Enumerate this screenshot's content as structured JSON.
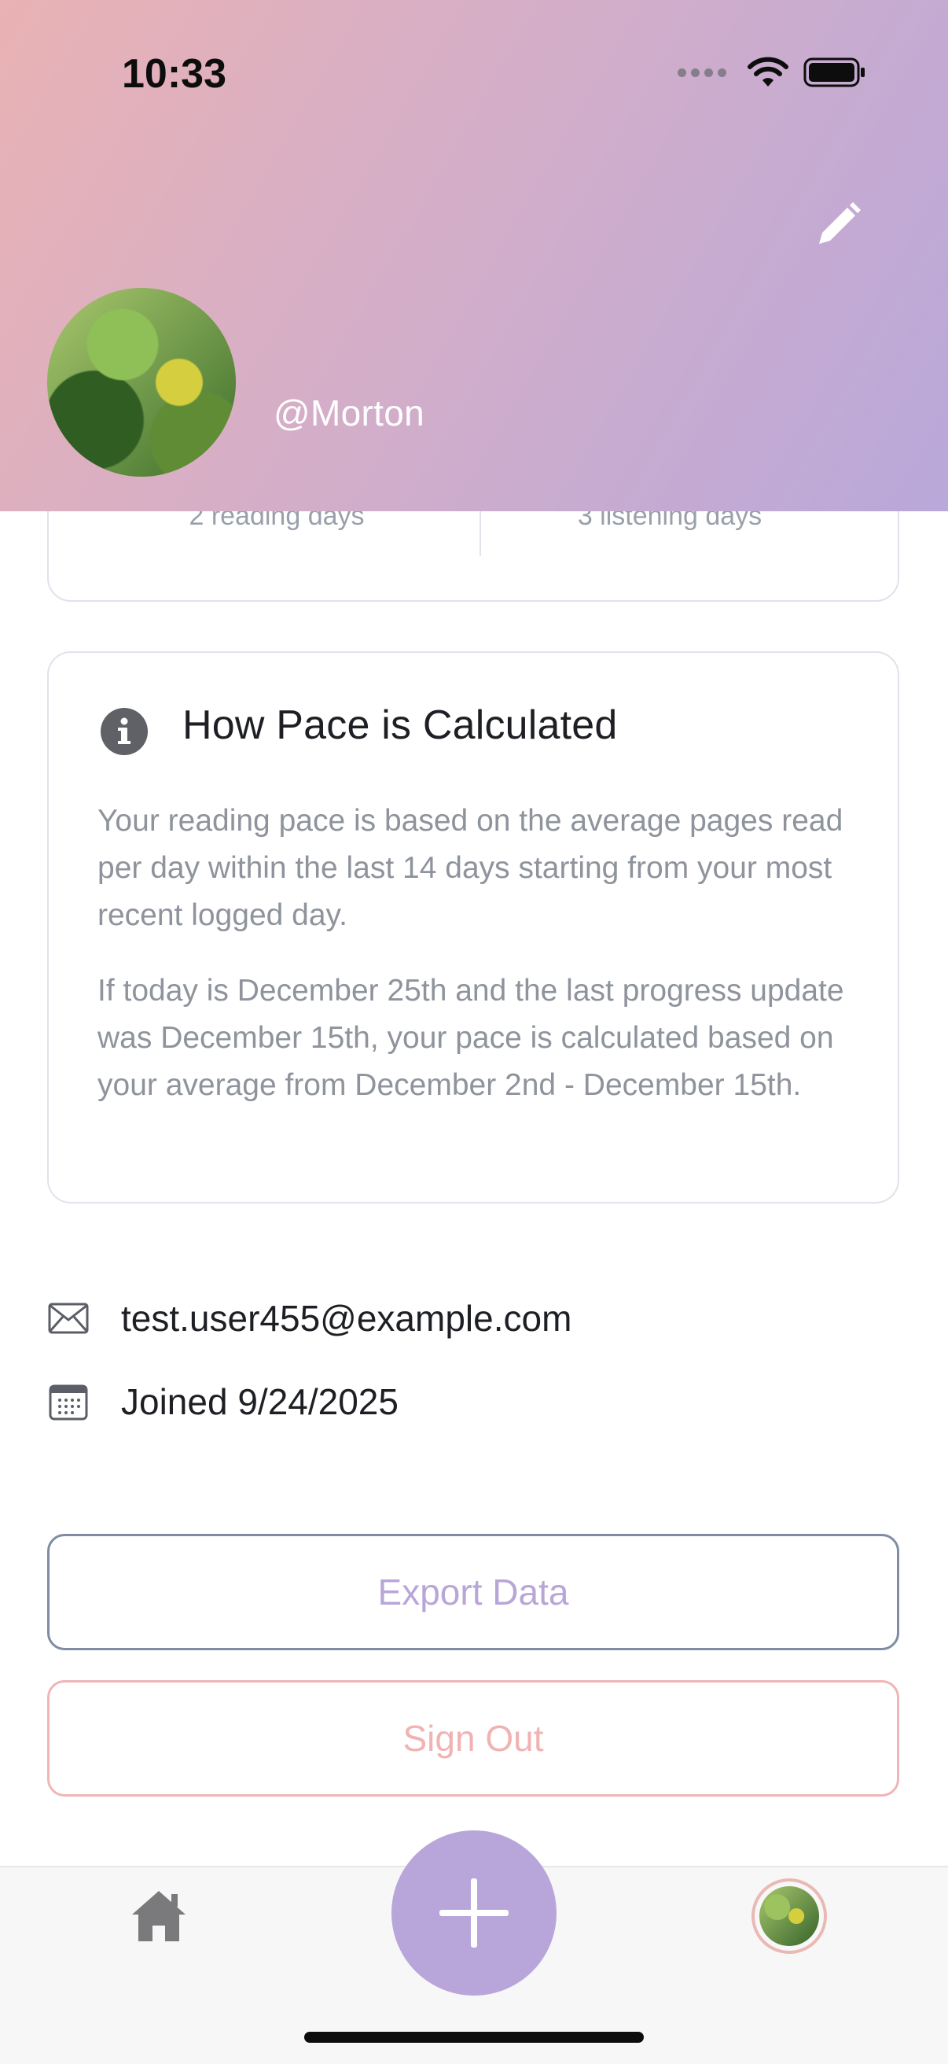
{
  "status_bar": {
    "time": "10:33"
  },
  "profile": {
    "username": "@Morton"
  },
  "stats": {
    "reading_days": "2 reading days",
    "listening_days": "3 listening days"
  },
  "pace_info": {
    "title": "How Pace is Calculated",
    "paragraph1": "Your reading pace is based on the average pages read per day within the last 14 days starting from your most recent logged day.",
    "paragraph2": "If today is December 25th and the last progress update was December 15th, your pace is calculated based on your average from December 2nd - December 15th."
  },
  "account": {
    "email": "test.user455@example.com",
    "joined": "Joined 9/24/2025"
  },
  "buttons": {
    "export": "Export Data",
    "signout": "Sign Out"
  },
  "colors": {
    "accent_purple": "#b8a6da",
    "accent_pink": "#f0b5b6",
    "export_border": "#7f8ca3"
  },
  "tab_bar": {
    "items": [
      "home-icon",
      "add-button",
      "profile-avatar"
    ]
  }
}
